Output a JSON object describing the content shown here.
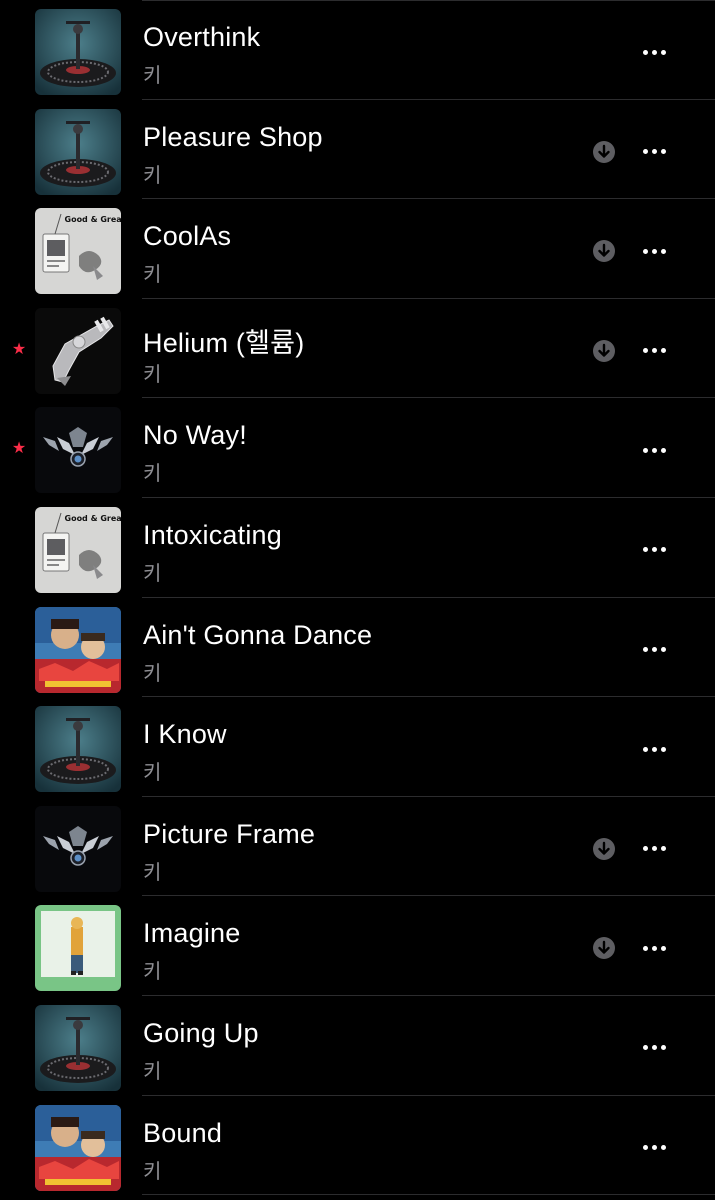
{
  "songs": [
    {
      "title": "Overthink",
      "artist": "키",
      "art": "space",
      "download": false,
      "favorite": false
    },
    {
      "title": "Pleasure Shop",
      "artist": "키",
      "art": "space",
      "download": true,
      "favorite": false
    },
    {
      "title": "CoolAs",
      "artist": "키",
      "art": "goodandgreat",
      "download": true,
      "favorite": false
    },
    {
      "title": "Helium (헬륨)",
      "artist": "키",
      "art": "raygun",
      "download": true,
      "favorite": true
    },
    {
      "title": "No Way!",
      "artist": "키",
      "art": "chrome",
      "download": false,
      "favorite": true
    },
    {
      "title": "Intoxicating",
      "artist": "키",
      "art": "goodandgreat",
      "download": false,
      "favorite": false
    },
    {
      "title": "Ain't Gonna Dance",
      "artist": "키",
      "art": "killerposter",
      "download": false,
      "favorite": false
    },
    {
      "title": "I Know",
      "artist": "키",
      "art": "space",
      "download": false,
      "favorite": false
    },
    {
      "title": "Picture Frame",
      "artist": "키",
      "art": "chrome",
      "download": true,
      "favorite": false
    },
    {
      "title": "Imagine",
      "artist": "키",
      "art": "green",
      "download": true,
      "favorite": false
    },
    {
      "title": "Going Up",
      "artist": "키",
      "art": "space",
      "download": false,
      "favorite": false
    },
    {
      "title": "Bound",
      "artist": "키",
      "art": "killerposter",
      "download": false,
      "favorite": false
    }
  ],
  "art_text": {
    "goodandgreat_logo": "Good & Great"
  },
  "icons": {
    "favorite": "star-icon",
    "download": "download-icon",
    "more": "more-icon"
  },
  "colors": {
    "background": "#000000",
    "title": "#ffffff",
    "subtitle": "#8e8e93",
    "favorite": "#fa2d48",
    "separator": "#2c2c2e"
  }
}
